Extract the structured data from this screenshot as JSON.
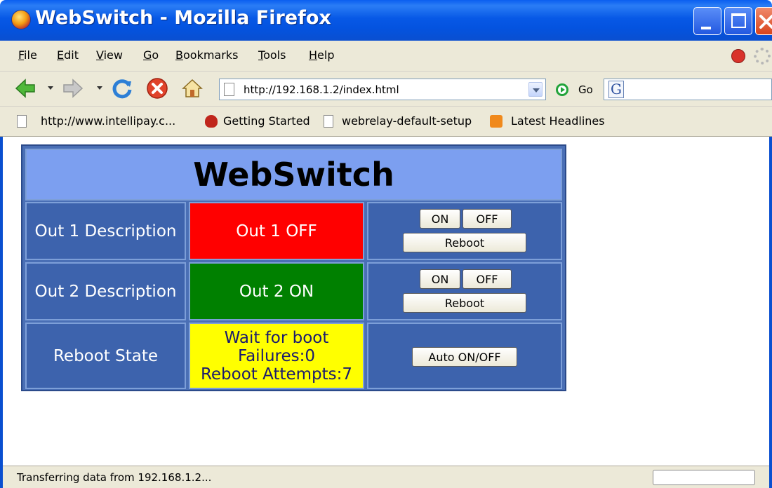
{
  "window": {
    "title": "WebSwitch - Mozilla Firefox"
  },
  "menu": [
    {
      "accel": "F",
      "rest": "ile"
    },
    {
      "accel": "E",
      "rest": "dit"
    },
    {
      "accel": "V",
      "rest": "iew"
    },
    {
      "accel": "G",
      "rest": "o"
    },
    {
      "accel": "B",
      "rest": "ookmarks"
    },
    {
      "accel": "T",
      "rest": "ools"
    },
    {
      "accel": "H",
      "rest": "elp"
    }
  ],
  "navigation": {
    "url": "http://192.168.1.2/index.html",
    "go_label": "Go",
    "search_icon_letter": "G",
    "icons": [
      "back-icon",
      "forward-icon",
      "reload-icon",
      "stop-icon",
      "home-icon"
    ]
  },
  "bookmarks": [
    {
      "label": "http://www.intellipay.c...",
      "icon": "page-icon"
    },
    {
      "label": "Getting Started",
      "icon": "getting-started-icon"
    },
    {
      "label": "webrelay-default-setup",
      "icon": "page-icon"
    },
    {
      "label": "Latest Headlines",
      "icon": "rss-icon"
    }
  ],
  "webswitch": {
    "title": "WebSwitch",
    "rows": [
      {
        "description": "Out 1 Description",
        "state": "Out 1 OFF",
        "state_color": "#ff0000",
        "on_label": "ON",
        "off_label": "OFF",
        "reboot_label": "Reboot"
      },
      {
        "description": "Out 2 Description",
        "state": "Out 2 ON",
        "state_color": "#008000",
        "on_label": "ON",
        "off_label": "OFF",
        "reboot_label": "Reboot"
      }
    ],
    "reboot_row": {
      "description": "Reboot State",
      "state_lines": [
        "Wait for boot",
        "Failures:0",
        "Reboot Attempts:7"
      ],
      "state_color": "#ffff00",
      "button_label": "Auto ON/OFF"
    }
  },
  "status": {
    "text": "Transferring data from 192.168.1.2..."
  },
  "colors": {
    "titlebar": "#0453df",
    "chrome": "#ece9d8",
    "table_header": "#7c9ff0",
    "table_cell": "#3d63ad"
  }
}
